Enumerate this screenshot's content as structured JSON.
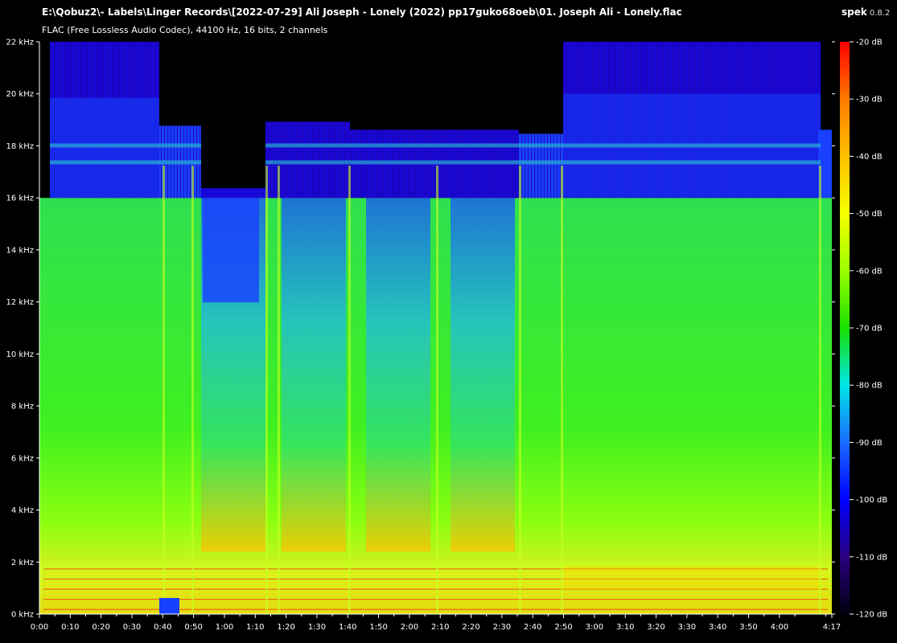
{
  "header": {
    "file_path": "E:\\Qobuz2\\- Labels\\Linger Records\\[2022-07-29] Ali Joseph - Lonely (2022) pp17guko68oeb\\01. Joseph Ali - Lonely.flac",
    "file_info": "FLAC (Free Lossless Audio Codec), 44100 Hz, 16 bits, 2 channels",
    "app_name": "spek",
    "app_version": "0.8.2"
  },
  "frequency_axis": {
    "labels": [
      "0 kHz",
      "2 kHz",
      "4 kHz",
      "6 kHz",
      "8 kHz",
      "10 kHz",
      "12 kHz",
      "14 kHz",
      "16 kHz",
      "18 kHz",
      "20 kHz",
      "22 kHz"
    ]
  },
  "time_axis": {
    "labels": [
      "0:00",
      "0:10",
      "0:20",
      "0:30",
      "0:40",
      "0:50",
      "1:00",
      "1:10",
      "1:20",
      "1:30",
      "1:40",
      "1:50",
      "2:00",
      "2:10",
      "2:20",
      "2:30",
      "2:40",
      "2:50",
      "3:00",
      "3:10",
      "3:20",
      "3:30",
      "3:40",
      "3:50",
      "4:00",
      "4:17"
    ]
  },
  "level_scale": {
    "labels": [
      "-20 dB",
      "-30 dB",
      "-40 dB",
      "-50 dB",
      "-60 dB",
      "-70 dB",
      "-80 dB",
      "-90 dB",
      "-100 dB",
      "-110 dB",
      "-120 dB"
    ],
    "colors": [
      "#ff0000",
      "#ff7a00",
      "#ffc000",
      "#f6ff00",
      "#9bff00",
      "#18e000",
      "#00e6e6",
      "#1a6bff",
      "#0000ff",
      "#2a0080",
      "#000010"
    ]
  },
  "spectrogram": {
    "colors": {
      "silence": "#000000",
      "quiet": "#1808d8",
      "hf": "#1840ff",
      "mid": "#2ee050",
      "loud": "#78ff10",
      "low": "#c8ff20",
      "hot": "#ffd800",
      "peak": "#ff3000",
      "cyan": "#28c8d0"
    }
  }
}
